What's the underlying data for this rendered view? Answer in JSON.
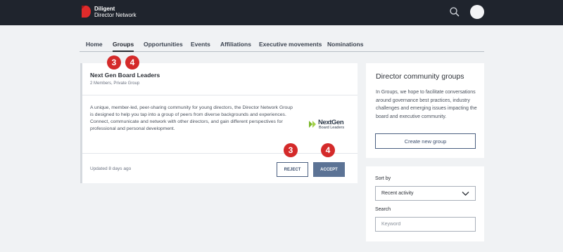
{
  "header": {
    "brand_line1": "Diligent",
    "brand_line2": "Director Network",
    "logo_icon": "diligent-logo-icon",
    "search_icon": "search-icon",
    "colors": {
      "bar": "#1f242d",
      "logo": "#e02b2b"
    }
  },
  "tabs": [
    {
      "label": "Home",
      "active": false
    },
    {
      "label": "Groups",
      "active": true
    },
    {
      "label": "Opportunities",
      "active": false
    },
    {
      "label": "Events",
      "active": false
    },
    {
      "label": "Affiliations",
      "active": false
    },
    {
      "label": "Executive movements",
      "active": false
    },
    {
      "label": "Nominations",
      "active": false
    }
  ],
  "group_card": {
    "title": "Next Gen Board Leaders",
    "subtitle": "2 Members, Private Group",
    "description": "A unique, member-led, peer-sharing community for young directors, the Director Network Group is designed to help you tap into a group of peers from diverse backgrounds and experiences. Connect, communicate and network with other directors, and gain different perspectives for professional and personal development.",
    "logo_title": "NextGen",
    "logo_subtitle": "Board Leaders",
    "updated": "Updated 8 days ago",
    "reject_label": "REJECT",
    "accept_label": "ACCEPT"
  },
  "step_badges": {
    "title_reject": "3",
    "title_accept": "4",
    "button_reject": "3",
    "button_accept": "4",
    "color": "#d42a2a"
  },
  "community_panel": {
    "title": "Director community groups",
    "text": "In Groups, we hope to facilitate conversations around governance best practices, industry challenges and emerging issues impacting the board and executive community.",
    "create_label": "Create new group"
  },
  "filter_panel": {
    "sort_label": "Sort by",
    "sort_value": "Recent activity",
    "search_label": "Search",
    "search_placeholder": "Keyword"
  }
}
